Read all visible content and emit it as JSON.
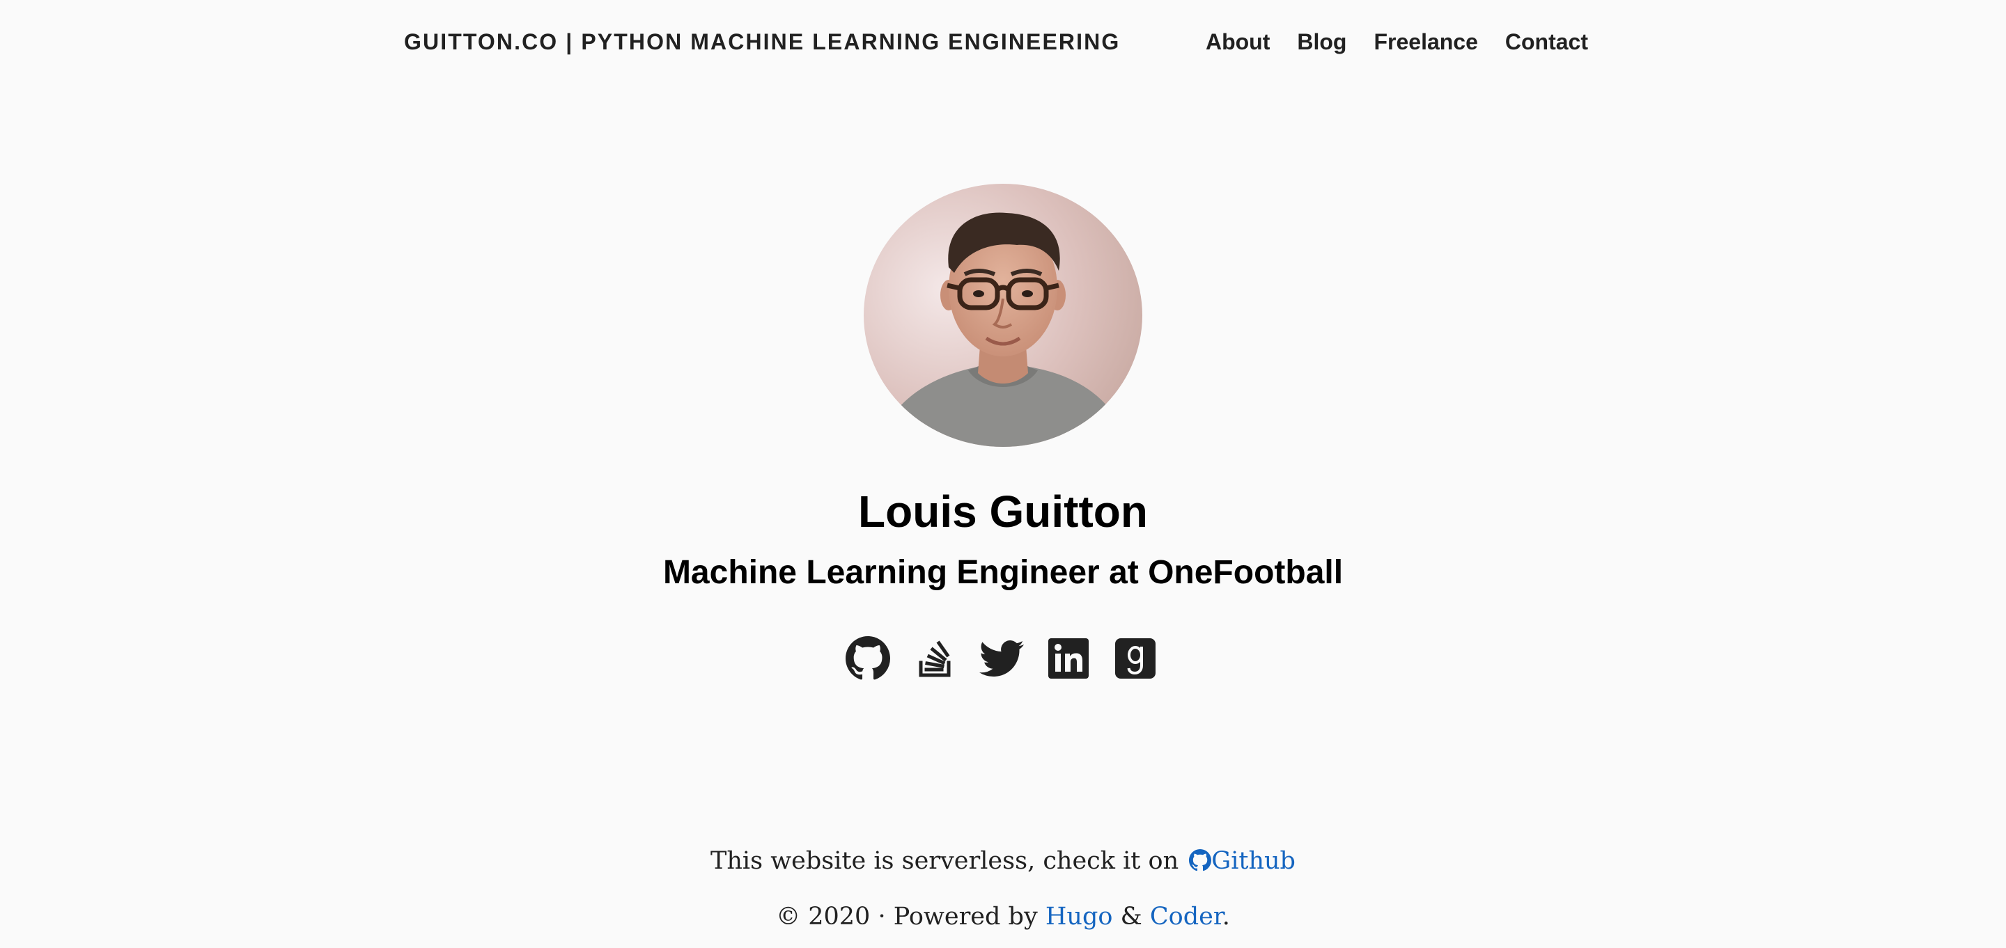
{
  "header": {
    "site_title": "GUITTON.CO | PYTHON MACHINE LEARNING ENGINEERING",
    "nav": [
      {
        "label": "About"
      },
      {
        "label": "Blog"
      },
      {
        "label": "Freelance"
      },
      {
        "label": "Contact"
      }
    ]
  },
  "profile": {
    "name": "Louis Guitton",
    "role": "Machine Learning Engineer at OneFootball",
    "avatar_icon": "avatar-photo"
  },
  "social": [
    {
      "icon": "github-icon"
    },
    {
      "icon": "stackoverflow-icon"
    },
    {
      "icon": "twitter-icon"
    },
    {
      "icon": "linkedin-icon"
    },
    {
      "icon": "goodreads-icon"
    }
  ],
  "footer": {
    "serverless_text": "This website is serverless, check it on",
    "github_link": "Github",
    "copyright": "© 2020 · Powered by",
    "hugo_link": "Hugo",
    "ampersand": "&",
    "coder_link": "Coder",
    "period": "."
  },
  "colors": {
    "background": "#fafafa",
    "text": "#212121",
    "link": "#1565c0"
  }
}
